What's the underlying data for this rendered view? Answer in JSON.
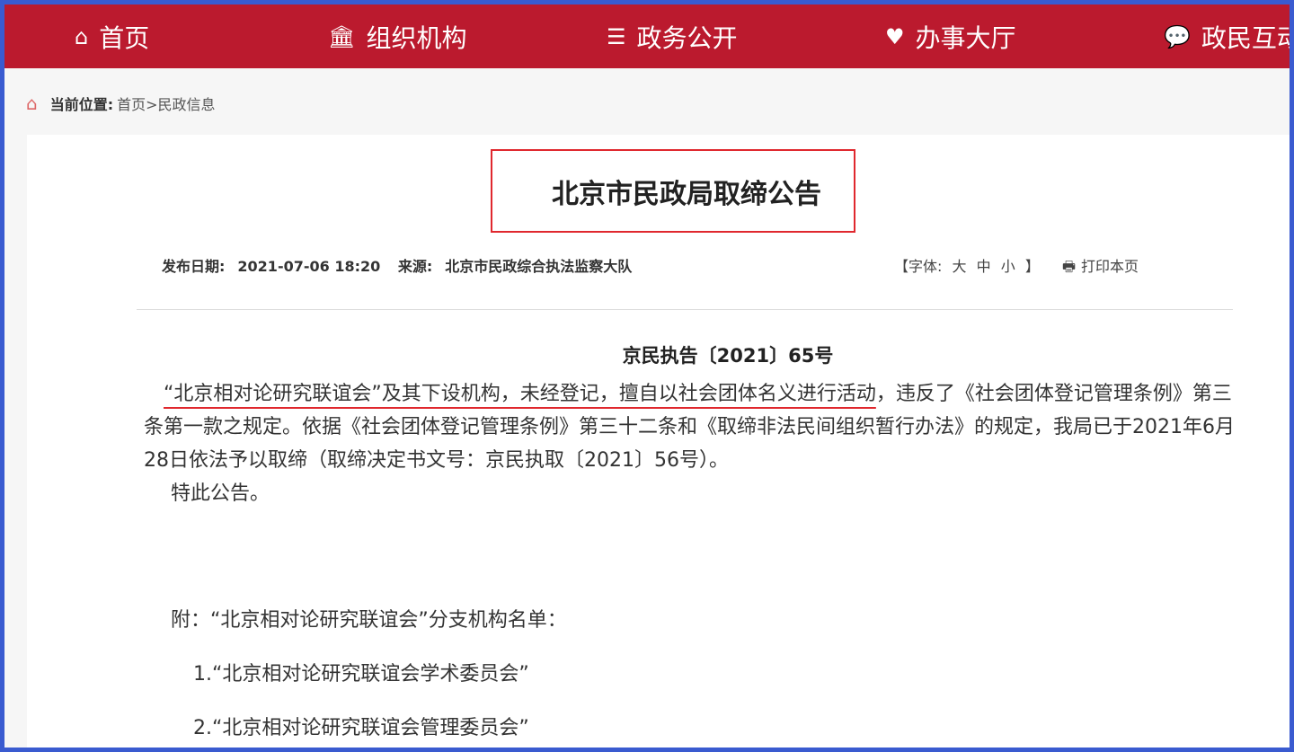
{
  "nav": [
    {
      "icon": "home-icon",
      "glyph": "⌂",
      "label": "首页"
    },
    {
      "icon": "institution-icon",
      "glyph": "🏛",
      "label": "组织机构"
    },
    {
      "icon": "list-icon",
      "glyph": "☰",
      "label": "政务公开"
    },
    {
      "icon": "heart-icon",
      "glyph": "♥",
      "label": "办事大厅"
    },
    {
      "icon": "chat-icon",
      "glyph": "💬",
      "label": "政民互动"
    }
  ],
  "breadcrumb": {
    "label": "当前位置:",
    "path": "首页>民政信息"
  },
  "article": {
    "title": "北京市民政局取缔公告",
    "date_label": "发布日期:",
    "date": "2021-07-06 18:20",
    "source_label": "来源:",
    "source": "北京市民政综合执法监察大队",
    "font_label": "【字体:",
    "font_large": "大",
    "font_medium": "中",
    "font_small": "小",
    "font_end": "】",
    "print": "打印本页",
    "doc_no": "京民执告〔2021〕65号",
    "para1_underlined": "“北京相对论研究联谊会”及其下设机构，未经登记，擅自以社会团体名义进行活动",
    "para1_rest": "，违反了《社会团体登记管理条例》第三条第一款之规定。依据《社会团体登记管理条例》第三十二条和《取缔非法民间组织暂行办法》的规定，我局已于2021年6月28日依法予以取缔（取缔决定书文号：京民执取〔2021〕56号）。",
    "para2": "特此公告。",
    "appendix": "附：“北京相对论研究联谊会”分支机构名单：",
    "items": [
      "1.“北京相对论研究联谊会学术委员会”",
      "2.“北京相对论研究联谊会管理委员会”"
    ]
  },
  "colors": {
    "nav": "#bb1a2e",
    "frame": "#3a5bd0",
    "highlight": "#e0282e"
  }
}
